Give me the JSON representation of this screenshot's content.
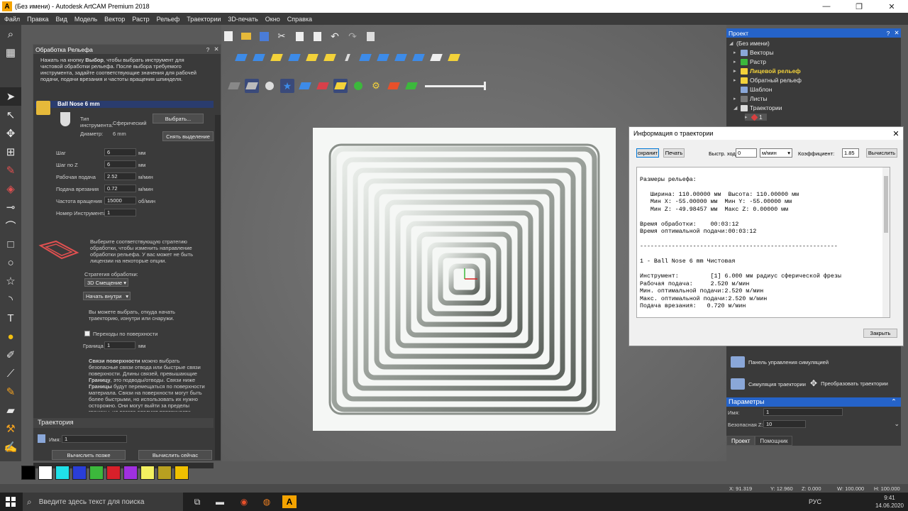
{
  "window": {
    "title": "(Без имени) - Autodesk ArtCAM Premium 2018",
    "min": "—",
    "max": "❐",
    "close": "✕"
  },
  "menu": [
    "Файл",
    "Правка",
    "Вид",
    "Модель",
    "Вектор",
    "Растр",
    "Рельеф",
    "Траектории",
    "3D-печать",
    "Окно",
    "Справка"
  ],
  "relief_panel": {
    "title": "Обработка Рельефа",
    "help": "?",
    "close": "✕",
    "desc_line1": "Нажать на кнопку ",
    "desc_bold": "Выбор",
    "desc_line2": ", чтобы выбрать инструмент для чистовой обработки рельефа. После выбора требуемого инструмента, задайте соответствующие значения для рабочей подачи, подачи врезания и частоты вращения шпинделя.",
    "tool_name": "Ball Nose 6 mm",
    "tool_type_label": "Тип инструмента:",
    "tool_type_value": "Сферический",
    "diameter_label": "Диаметр:",
    "diameter_value": "6 mm",
    "select_button": "Выбрать...",
    "deselect_button": "Снять выделение",
    "fields": [
      {
        "label": "Шаг",
        "value": "6",
        "unit": "мм"
      },
      {
        "label": "Шаг по Z",
        "value": "6",
        "unit": "мм"
      },
      {
        "label": "Рабочая подача",
        "value": "2.52",
        "unit": "м/мин"
      },
      {
        "label": "Подача врезания",
        "value": "0.72",
        "unit": "м/мин"
      },
      {
        "label": "Частота вращения",
        "value": "15000",
        "unit": "об/мин"
      },
      {
        "label": "Номер Инструмента",
        "value": "1",
        "unit": ""
      }
    ],
    "strategy_hint": "Выберите соответствующую стратегию обработки, чтобы изменить направление обработки рельефа. У вас может не быть лицензии на некоторые опции.",
    "strategy_label": "Стратегия обработки:",
    "strategy_value": "3D Смещение",
    "start_value": "Начать внутри",
    "start_hint": "Вы можете выбрать, откуда начать траекторию, изнутри или снаружи.",
    "surface_transitions": "Переходы по поверхности",
    "boundary_label": "Граница",
    "boundary_value": "1",
    "boundary_unit": "мм",
    "links_bold": "Связи поверхности",
    "links_text1": " можно выбрать безопасные связи отвода или быстрые связи поверхности. Длины связей, превышающие ",
    "links_bold2": "Границу",
    "links_text2": ", это подводы/отводы. Связи ниже ",
    "links_bold3": "Границы",
    "links_text3": " будут перемещаться по поверхности материала. Связи на поверхности могут быть более быстрыми, но использовать их нужно осторожно. Они могут выйти за пределы границы, но всегда следуют поверхности",
    "trajectory_header": "Траектория",
    "name_label": "Имя:",
    "name_value": "1",
    "calc_later": "Вычислить позже",
    "calc_now": "Вычислить сейчас"
  },
  "project_panel": {
    "title": "Проект",
    "help": "?",
    "close": "✕",
    "items": [
      "(Без имени)",
      "Векторы",
      "Растр",
      "Лицевой рельеф",
      "Обратный рельеф",
      "Шаблон",
      "Листы",
      "Траектории",
      "1"
    ]
  },
  "info_dialog": {
    "title": "Информация о траектории",
    "close": "✕",
    "save": "охранит",
    "print": "Печать",
    "rapid_label": "Быстр. ход",
    "rapid_value": "0",
    "rapid_unit": "м/мин",
    "coef_label": "Коэффициент:",
    "coef_value": "1.85",
    "calc": "Вычислить",
    "close_btn": "Закрыть",
    "report": "\nРазмеры рельефа:\n\n   Ширина: 110.00000 мм  Высота: 110.00000 мм\n   Мин X: -55.00000 мм  Мин Y: -55.00000 мм\n   Мин Z: -49.98457 мм  Макс Z: 0.00000 мм\n\nВремя обработки:    00:03:12\nВремя оптимальной подачи:00:03:12\n\n--------------------------------------------------------\n\n1 - Ball Nose 6 mm Чистовая\n\nИнструмент:         [1] 6.000 мм радиус сферической фрезы\nРабочая подача:     2.520 м/мин\nМин. оптимальной подачи:2.520 м/мин\nМакс. оптимальной подачи:2.520 м/мин\nПодача врезания:   0.720 м/мин"
  },
  "sim_panel": {
    "control": "Панель управления симуляцией",
    "simulate": "Симуляция траектории",
    "transform": "Преобразовать траектории"
  },
  "params_panel": {
    "title": "Параметры",
    "name_label": "Имя:",
    "name_value": "1",
    "safe_z_label": "Безопасная Z:",
    "safe_z_value": "10"
  },
  "tabs": [
    "Проект",
    "Помощник"
  ],
  "palette_colors": [
    "#000000",
    "#ffffff",
    "#20e0e8",
    "#2a3ed8",
    "#3cb83c",
    "#d8202a",
    "#a030e0",
    "#f3f060",
    "#b8a020",
    "#f0c000"
  ],
  "status": {
    "x": "X: 91.319",
    "y": "Y: 12.960",
    "z": "Z: 0.000",
    "w": "W: 100.000",
    "h": "H: 100.000"
  },
  "taskbar": {
    "search_placeholder": "Введите здесь текст для поиска",
    "lang": "РУС",
    "time": "9:41",
    "date": "14.06.2020"
  }
}
